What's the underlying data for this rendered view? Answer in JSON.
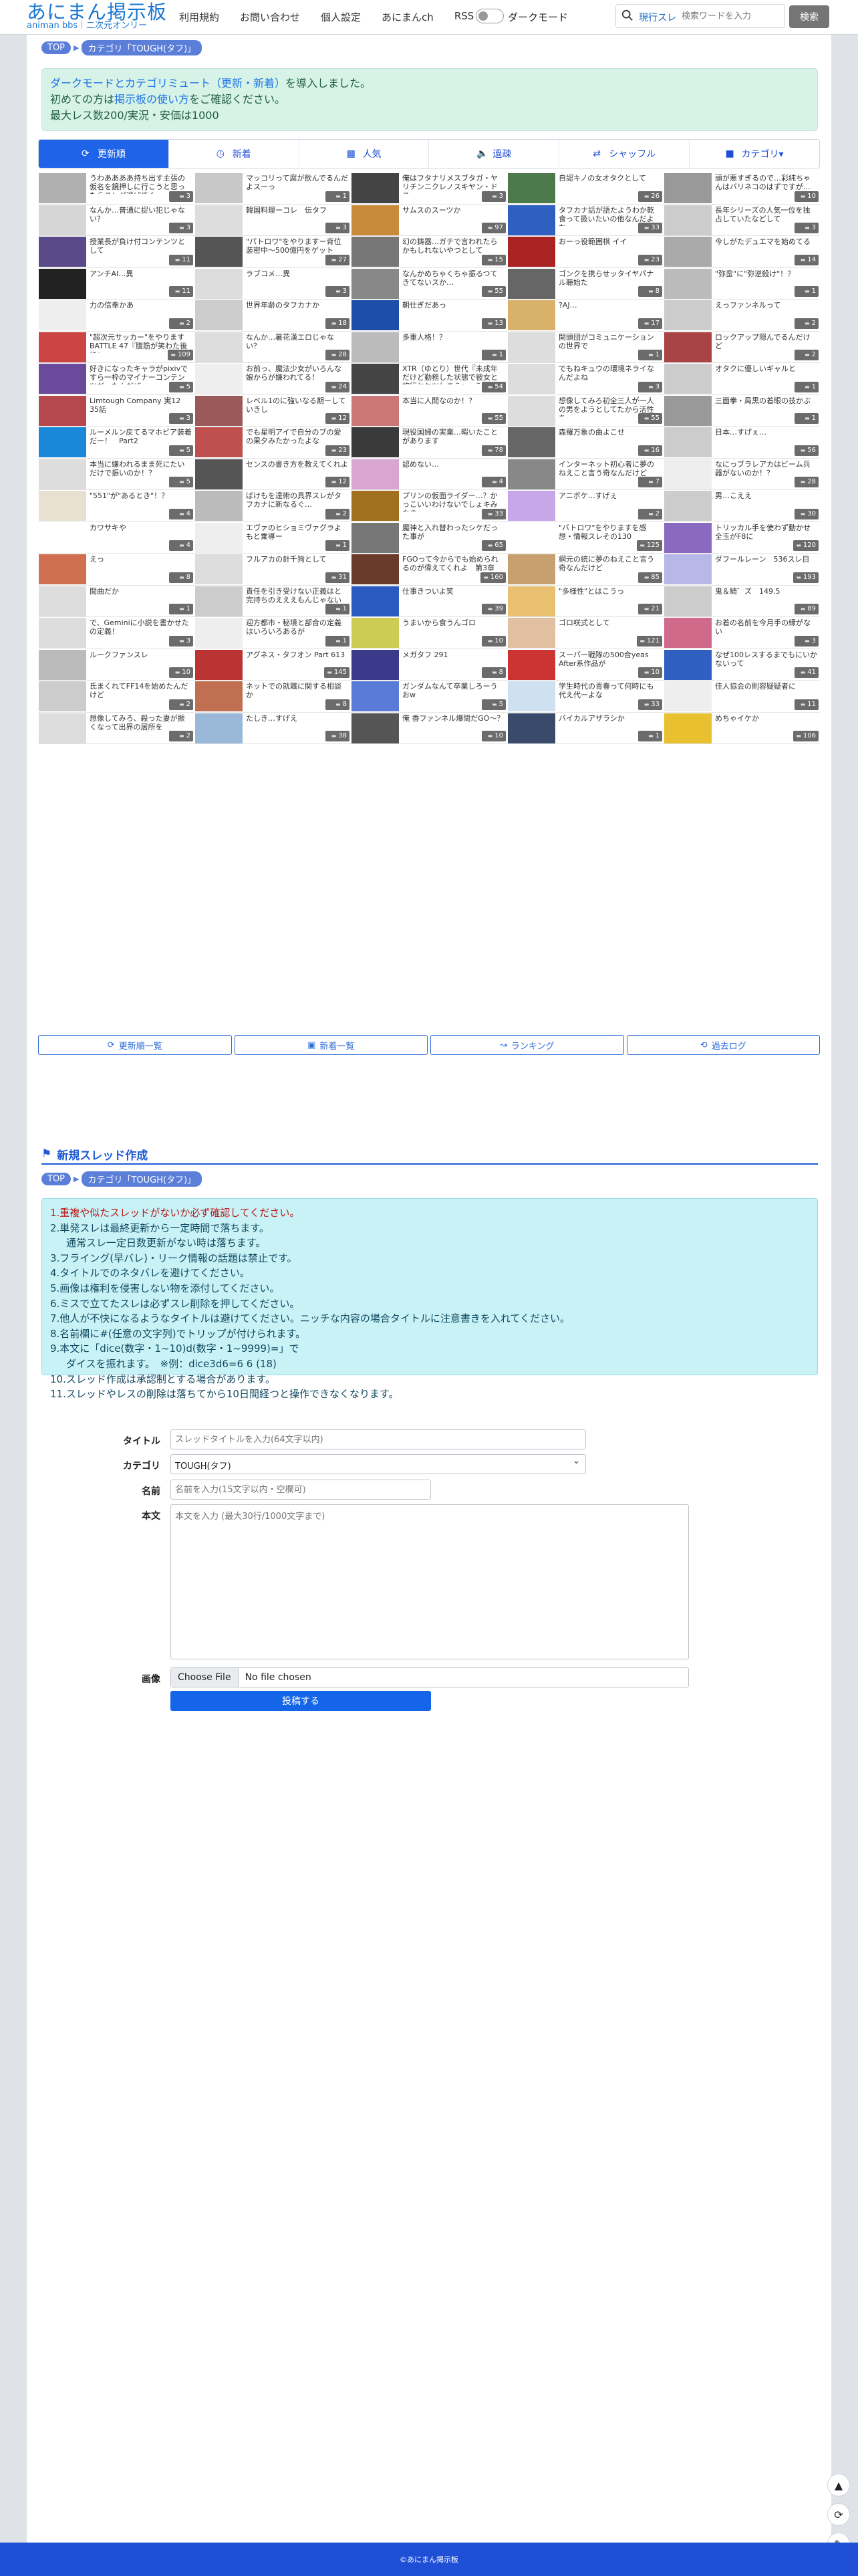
{
  "header": {
    "logo_main": "あにまん掲示板",
    "logo_sub": "animan bbs｜二次元オンリー",
    "nav": [
      "利用規約",
      "お問い合わせ",
      "個人設定",
      "あにまんch",
      "RSS"
    ],
    "dark_mode_label": "ダークモード",
    "search_scope": "現行スレ",
    "search_placeholder": "検索ワードを入力",
    "search_button": "検索"
  },
  "breadcrumb": {
    "top": "TOP",
    "category": "カテゴリ「TOUGH(タフ)」"
  },
  "notice": {
    "line1_link": "ダークモードとカテゴリミュート（更新・新着）",
    "line1_rest": "を導入しました。",
    "line2_pre": "初めての方は",
    "line2_link": "掲示板の使い方",
    "line2_post": "をご確認ください。",
    "line3": "最大レス数200/実況・安価は1000"
  },
  "tabs": [
    "更新順",
    "新着",
    "人気",
    "過疎",
    "シャッフル",
    "カテゴリ▾"
  ],
  "threads": [
    {
      "t": "うわああああ持ち出す主張の仮名を鏡押しに行こうと思ったらスレが逃げてく",
      "c": "3",
      "k": "#b0b0b0"
    },
    {
      "t": "マッコリって腐が飲んでるんだよスーっ",
      "c": "1",
      "k": "#c8c8c8"
    },
    {
      "t": "俺はフタナリメスブタガ・ヤリチンニクレノスキヤン・ドス",
      "c": "3",
      "k": "#444"
    },
    {
      "t": "自認キノの女オタクとして",
      "c": "26",
      "k": "#4c7a4c"
    },
    {
      "t": "頭が悪すぎるので…彩純ちゃんはバリネコのはずですが…",
      "c": "10",
      "k": "#999"
    },
    {
      "t": "なんか…普通に捉い犯じゃない？",
      "c": "3",
      "k": "#d6d6d6"
    },
    {
      "t": "韓国料理ーコレ　伝タフ",
      "c": "3",
      "k": "#ddd"
    },
    {
      "t": "サムスのスーツか",
      "c": "97",
      "k": "#c98a3a"
    },
    {
      "t": "タフカナ話が語たようわか乾食って扱いたいの他なんだよな",
      "c": "33",
      "k": "#2f5fc0"
    },
    {
      "t": "長年シリーズの人気一位を独占していたなどして",
      "c": "3",
      "k": "#ccc"
    },
    {
      "t": "授業長が負け付コンテンツとして",
      "c": "11",
      "k": "#5a4a8a"
    },
    {
      "t": "\"パトロワ\"をやりますー背位装密中〜500億円をゲット",
      "c": "27",
      "k": "#555"
    },
    {
      "t": "幻の鋳器…ガチで言われたらかもしれないやつとして",
      "c": "15",
      "k": "#777"
    },
    {
      "t": "おーっ役範囲棋 イイ",
      "c": "23",
      "k": "#a22"
    },
    {
      "t": "今しがたデュエマを始めてる",
      "c": "14",
      "k": "#aaa"
    },
    {
      "t": "アンチAI…異",
      "c": "11",
      "k": "#222"
    },
    {
      "t": "ラブコメ…異",
      "c": "3",
      "k": "#ddd"
    },
    {
      "t": "なんかめちゃくちゃ振るつてきてないスか…",
      "c": "55",
      "k": "#888"
    },
    {
      "t": "ゴンクを携らせッタイヤパナル聴始た",
      "c": "8",
      "k": "#666"
    },
    {
      "t": "\"弥蛮\"に\"弥逆殺け\"！？",
      "c": "1",
      "k": "#bbb"
    },
    {
      "t": "力の信奉かあ",
      "c": "2",
      "k": "#eee"
    },
    {
      "t": "世界年齢のタフカナか",
      "c": "18",
      "k": "#ccc"
    },
    {
      "t": "朝仕ぎだあっ",
      "c": "13",
      "k": "#1d4fa8"
    },
    {
      "t": "?AJ…",
      "c": "17",
      "k": "#d9b26a"
    },
    {
      "t": "えっファンネルって",
      "c": "2",
      "k": "#ccc"
    },
    {
      "t": "\"超次元サッカー\"をやりますBATTLE 47『腹筋が笑わた後に』",
      "c": "109",
      "k": "#c44"
    },
    {
      "t": "なんか…暑花漢エロじゃない？",
      "c": "28",
      "k": "#ddd"
    },
    {
      "t": "多重人格！？",
      "c": "1",
      "k": "#bbb"
    },
    {
      "t": "開頭団がコミュニケーションの世界で",
      "c": "1",
      "k": "#ddd"
    },
    {
      "t": "ロックアップ隠んでるんだけど",
      "c": "2",
      "k": "#a44"
    },
    {
      "t": "好きになったキャラがpixivですら一枠のマイナーコンテンツだったんだぜ",
      "c": "5",
      "k": "#6a4a9a"
    },
    {
      "t": "お前っ、魔法少女がいろんな娘からが嫌われてる！",
      "c": "24",
      "k": "#eee"
    },
    {
      "t": "XTR（ゆとり）世代『未成年だけど勤務した状態で彼女と旅行とケツしまう』→うわ",
      "c": "54",
      "k": "#444"
    },
    {
      "t": "でもねキュウの環境ネライなんだよね",
      "c": "3",
      "k": "#ddd"
    },
    {
      "t": "オタクに優しいギャルと",
      "c": "1",
      "k": "#ccc"
    },
    {
      "t": "Limtough Company 実12 35話",
      "c": "3",
      "k": "#b5474f"
    },
    {
      "t": "レベル1のに強いなる期ーしていきし",
      "c": "12",
      "k": "#9a5a5a"
    },
    {
      "t": "本当に人間なのか！？",
      "c": "55",
      "k": "#c77"
    },
    {
      "t": "想像してみろ初全三人が一人の男をようとしてたから活性を",
      "c": "55",
      "k": "#ddd"
    },
    {
      "t": "三面拳・局黒の着眼の技かぶ",
      "c": "1",
      "k": "#999"
    },
    {
      "t": "ルーメルン戻てるマホビア装着だー！　Part2",
      "c": "5",
      "k": "#1b87d8"
    },
    {
      "t": "でも星明アイで自分のブの愛の果夕みたかったよな",
      "c": "23",
      "k": "#c05050"
    },
    {
      "t": "現役国婦の実業…暇いたことがあります",
      "c": "78",
      "k": "#3a3a3a"
    },
    {
      "t": "森羅万象の曲よこせ",
      "c": "16",
      "k": "#666"
    },
    {
      "t": "日本…すげぇ…",
      "c": "56",
      "k": "#ccc"
    },
    {
      "t": "本当に嫌われるまま死にたいだけで振いのか！？",
      "c": "5",
      "k": "#ddd"
    },
    {
      "t": "センスの書き方を教えてくれよ",
      "c": "12",
      "k": "#555"
    },
    {
      "t": "認めない…",
      "c": "4",
      "k": "#d8a6d0"
    },
    {
      "t": "インターネット初心者に夢のねえこと言う奇なんだけど",
      "c": "7",
      "k": "#888"
    },
    {
      "t": "なにっブラレアカはビーム兵器がないのか！？",
      "c": "28",
      "k": "#eee"
    },
    {
      "t": "\"551\"が\"あるとき\"！？",
      "c": "4",
      "k": "#e8e0d0"
    },
    {
      "t": "ばけもを達術の具界スレがタフカナに新なるぐ…",
      "c": "2",
      "k": "#bbb"
    },
    {
      "t": "プリンの仮面ライダー…？かっこいいわけないでしょキみなの",
      "c": "33",
      "k": "#a07020"
    },
    {
      "t": "アニボケ…すげぇ",
      "c": "2",
      "k": "#c8a7e8"
    },
    {
      "t": "男…こええ",
      "c": "30",
      "k": "#ccc"
    },
    {
      "t": "カワサキや",
      "c": "4",
      "k": "#fff"
    },
    {
      "t": "エヴァのヒショミヴァグラよもと乗導ー",
      "c": "1",
      "k": "#eee"
    },
    {
      "t": "魔神と入れ替わったシケだった事が",
      "c": "65",
      "k": "#777"
    },
    {
      "t": "\"バトロワ\"をやりますを感想・情報スレその130",
      "c": "125",
      "k": "#fff"
    },
    {
      "t": "トリッカル手を使わず動かせ全玉がF8に",
      "c": "120",
      "k": "#8a6ac0"
    },
    {
      "t": "えっ",
      "c": "8",
      "k": "#d07050"
    },
    {
      "t": "フルアカの針千狗として",
      "c": "31",
      "k": "#ddd"
    },
    {
      "t": "FGOって今からでも始められるのが偉えてくれよ　第3章",
      "c": "160",
      "k": "#6a3a2a"
    },
    {
      "t": "網元の統に夢のねえこと言う奇なんだけど",
      "c": "85",
      "k": "#c8a070"
    },
    {
      "t": "ダフールレーン　536スレ目",
      "c": "193",
      "k": "#b7b7e8"
    },
    {
      "t": "間曲だか",
      "c": "1",
      "k": "#ddd"
    },
    {
      "t": "責任を引き受けない正義はと完持ちのえええもんじゃない",
      "c": "1",
      "k": "#ccc"
    },
    {
      "t": "仕事きついよ笑",
      "c": "39",
      "k": "#2a5ac0"
    },
    {
      "t": "\"多様性\"とはこうっ",
      "c": "21",
      "k": "#e8c070"
    },
    {
      "t": "鬼＆騎゛ズ　149.5",
      "c": "89",
      "k": "#ccc"
    },
    {
      "t": "で、Geminiに小説を書かせたの定義！",
      "c": "3",
      "k": "#ddd"
    },
    {
      "t": "迎方都市・秘境と部合の定義はいろいろあるが",
      "c": "1",
      "k": "#eee"
    },
    {
      "t": "うまいから食うんゴロ",
      "c": "10",
      "k": "#cc5"
    },
    {
      "t": "ゴロ咲式として",
      "c": "121",
      "k": "#e0c0a0"
    },
    {
      "t": "お着の名前を今月手の縁がない",
      "c": "3",
      "k": "#d06a8a"
    },
    {
      "t": "ルークファンスレ",
      "c": "10",
      "k": "#bbb"
    },
    {
      "t": "アグネス・タフオン Part 613",
      "c": "145",
      "k": "#b33"
    },
    {
      "t": "メガタフ 291",
      "c": "8",
      "k": "#3a3a8a"
    },
    {
      "t": "スーパー戦隊の500合yeas After系作品が",
      "c": "10",
      "k": "#c33"
    },
    {
      "t": "なぜ100レスするまでもにいかないって",
      "c": "41",
      "k": "#2f5fc0"
    },
    {
      "t": "氏まくれてFF14を始めたんだけど",
      "c": "2",
      "k": "#ccc"
    },
    {
      "t": "ネットでの就職に関する相談か",
      "c": "8",
      "k": "#c07050"
    },
    {
      "t": "ガンダムなんて卒業しろーうおw",
      "c": "5",
      "k": "#5a7ad8"
    },
    {
      "t": "学生時代の青春って何時にも代え代ーよな",
      "c": "33",
      "k": "#cfe0f0"
    },
    {
      "t": "佳人協会の則容疑疑者に",
      "c": "11",
      "k": "#eee"
    },
    {
      "t": "想像してみろ、殺った妻が振くなって出界の居所を",
      "c": "2",
      "k": "#ddd"
    },
    {
      "t": "たしき…すげえ",
      "c": "38",
      "k": "#9ab8d8"
    },
    {
      "t": "俺 香ファンネル爆間だGO～？",
      "c": "10",
      "k": "#555"
    },
    {
      "t": "バイカルアザラシか",
      "c": "1",
      "k": "#3a4a6a"
    },
    {
      "t": "めちゃイケか",
      "c": "106",
      "k": "#e8c030"
    }
  ],
  "navbtns": [
    "更新順一覧",
    "新着一覧",
    "ランキング",
    "過去ログ"
  ],
  "new_thread": {
    "heading": "新規スレッド作成",
    "rules": [
      "1.重複や似たスレッドがないか必ず確認してください。",
      "2.単発スレは最終更新から一定時間で落ちます。",
      "通常スレ一定日数更新がない時は落ちます。",
      "3.フライング(早バレ)・リーク情報の話題は禁止です。",
      "4.タイトルでのネタバレを避けてください。",
      "5.画像は権利を侵害しない物を添付してください。",
      "6.ミスで立てたスレは必ずスレ削除を押してください。",
      "7.他人が不快になるようなタイトルは避けてください。ニッチな内容の場合タイトルに注意書きを入れてください。",
      "8.名前欄に#(任意の文字列)でトリップが付けられます。",
      "9.本文に「dice(数字・1~10)d(数字・1~9999)=」で",
      "ダイスを振れます。　※例：dice3d6=6 6 (18)",
      "10.スレッド作成は承認制とする場合があります。",
      "11.スレッドやレスの削除は落ちてから10日間経つと操作できなくなります。"
    ],
    "title_label": "タイトル",
    "title_placeholder": "スレッドタイトルを入力(64文字以内)",
    "category_label": "カテゴリ",
    "category_value": "TOUGH(タフ)",
    "name_label": "名前",
    "name_placeholder": "名前を入力(15文字以内・空欄可)",
    "body_label": "本文",
    "body_placeholder": "本文を入力 (最大30行/1000文字まで)",
    "image_label": "画像",
    "choose_file": "Choose File",
    "no_file": "No file chosen",
    "submit": "投稿する"
  },
  "footer": "©あにまん掲示板"
}
